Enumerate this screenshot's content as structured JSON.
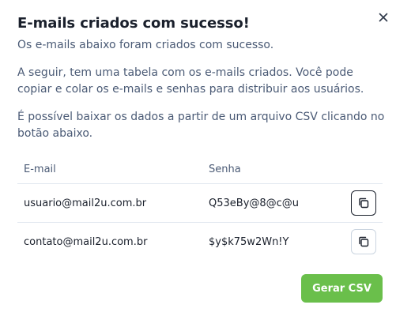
{
  "modal": {
    "title": "E-mails criados com sucesso!",
    "close_icon": "close-icon",
    "paragraphs": [
      "Os e-mails abaixo foram criados com sucesso.",
      "A seguir, tem uma tabela com os e-mails criados. Você pode copiar e colar os e-mails e senhas para distribuir aos usuários.",
      "É possível baixar os dados a partir de um arquivo CSV clicando no botão abaixo."
    ],
    "table": {
      "headers": [
        "E-mail",
        "Senha"
      ],
      "rows": [
        {
          "email": "usuario@mail2u.com.br",
          "password": "Q53eBy@8@c@u",
          "copy_icon": "copy-icon"
        },
        {
          "email": "contato@mail2u.com.br",
          "password": "$y$k75w2Wn!Y",
          "copy_icon": "copy-icon"
        }
      ]
    },
    "csv_button_label": "Gerar CSV",
    "colors": {
      "accent": "#6abf4b",
      "title": "#1a202c",
      "text": "#4a5a75"
    }
  }
}
